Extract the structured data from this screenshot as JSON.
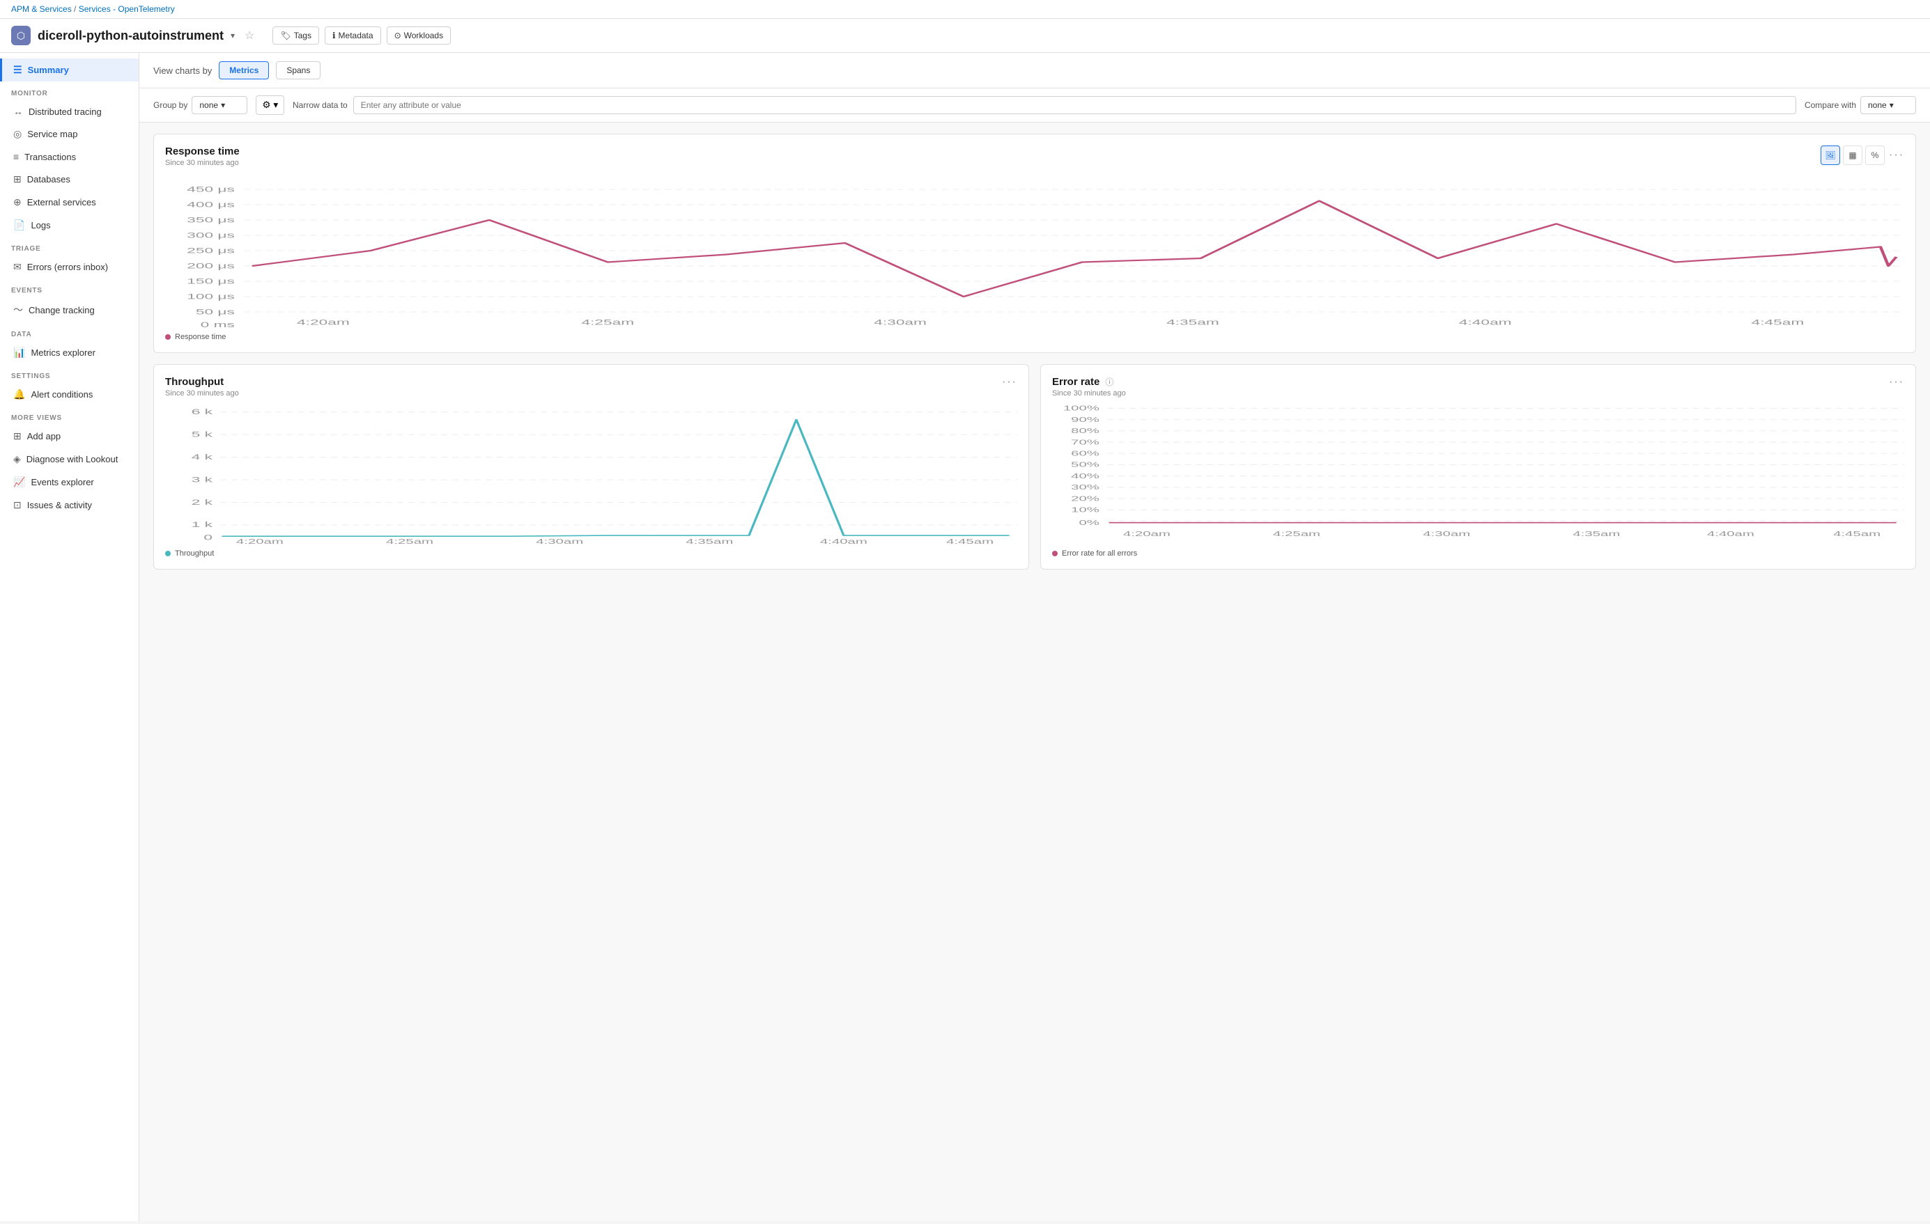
{
  "breadcrumb": {
    "parts": [
      "APM & Services",
      "Services - OpenTelemetry"
    ],
    "separator": "/"
  },
  "header": {
    "app_icon": "⬡",
    "title": "diceroll-python-autoinstrument",
    "has_dropdown": true,
    "buttons": [
      {
        "label": "Tags",
        "icon": "🏷"
      },
      {
        "label": "Metadata",
        "icon": "ℹ"
      },
      {
        "label": "Workloads",
        "icon": "⊙"
      }
    ]
  },
  "sidebar": {
    "active": "summary",
    "sections": [
      {
        "label": "",
        "items": [
          {
            "id": "summary",
            "label": "Summary",
            "icon": "☰"
          }
        ]
      },
      {
        "label": "MONITOR",
        "items": [
          {
            "id": "distributed-tracing",
            "label": "Distributed tracing",
            "icon": "↔"
          },
          {
            "id": "service-map",
            "label": "Service map",
            "icon": "◎"
          },
          {
            "id": "transactions",
            "label": "Transactions",
            "icon": "≡"
          },
          {
            "id": "databases",
            "label": "Databases",
            "icon": "⊞"
          },
          {
            "id": "external-services",
            "label": "External services",
            "icon": "⊕"
          },
          {
            "id": "logs",
            "label": "Logs",
            "icon": "📄"
          }
        ]
      },
      {
        "label": "TRIAGE",
        "items": [
          {
            "id": "errors",
            "label": "Errors (errors inbox)",
            "icon": "✉"
          }
        ]
      },
      {
        "label": "EVENTS",
        "items": [
          {
            "id": "change-tracking",
            "label": "Change tracking",
            "icon": "~"
          }
        ]
      },
      {
        "label": "DATA",
        "items": [
          {
            "id": "metrics-explorer",
            "label": "Metrics explorer",
            "icon": "📊"
          }
        ]
      },
      {
        "label": "SETTINGS",
        "items": [
          {
            "id": "alert-conditions",
            "label": "Alert conditions",
            "icon": "🔔"
          }
        ]
      },
      {
        "label": "MORE VIEWS",
        "items": [
          {
            "id": "add-app",
            "label": "Add app",
            "icon": "⊞"
          },
          {
            "id": "diagnose-lookout",
            "label": "Diagnose with Lookout",
            "icon": "◈"
          },
          {
            "id": "events-explorer",
            "label": "Events explorer",
            "icon": "📈"
          },
          {
            "id": "issues-activity",
            "label": "Issues & activity",
            "icon": "⊡"
          }
        ]
      }
    ]
  },
  "view_charts": {
    "label": "View charts by",
    "tabs": [
      {
        "id": "metrics",
        "label": "Metrics",
        "active": true
      },
      {
        "id": "spans",
        "label": "Spans",
        "active": false
      }
    ]
  },
  "controls": {
    "group_by_label": "Group by",
    "group_by_value": "none",
    "narrow_label": "Narrow data to",
    "narrow_placeholder": "Enter any attribute or value",
    "compare_label": "Compare with",
    "compare_value": "none"
  },
  "response_time_chart": {
    "title": "Response time",
    "subtitle": "Since 30 minutes ago",
    "y_labels": [
      "450 μs",
      "400 μs",
      "350 μs",
      "300 μs",
      "250 μs",
      "200 μs",
      "150 μs",
      "100 μs",
      "50 μs",
      "0 ms"
    ],
    "x_labels": [
      "4:20am",
      "4:25am",
      "4:30am",
      "4:35am",
      "4:40am",
      "4:45am"
    ],
    "legend": "Response time",
    "legend_color": "#c0507a",
    "more_label": "···"
  },
  "throughput_chart": {
    "title": "Throughput",
    "subtitle": "Since 30 minutes ago",
    "y_labels": [
      "6 k",
      "5 k",
      "4 k",
      "3 k",
      "2 k",
      "1 k",
      "0"
    ],
    "x_labels": [
      "4:20am",
      "4:25am",
      "4:30am",
      "4:35am",
      "4:40am",
      "4:45am"
    ],
    "legend": "Throughput",
    "legend_color": "#4ab8c1",
    "more_label": "···"
  },
  "error_rate_chart": {
    "title": "Error rate",
    "subtitle": "Since 30 minutes ago",
    "y_labels": [
      "100%",
      "90%",
      "80%",
      "70%",
      "60%",
      "50%",
      "40%",
      "30%",
      "20%",
      "10%",
      "0%"
    ],
    "x_labels": [
      "4:20am",
      "4:25am",
      "4:30am",
      "4:35am",
      "4:40am",
      "4:45am"
    ],
    "legend": "Error rate for all errors",
    "legend_color": "#c0507a",
    "more_label": "···",
    "info_icon": "ⓘ"
  }
}
